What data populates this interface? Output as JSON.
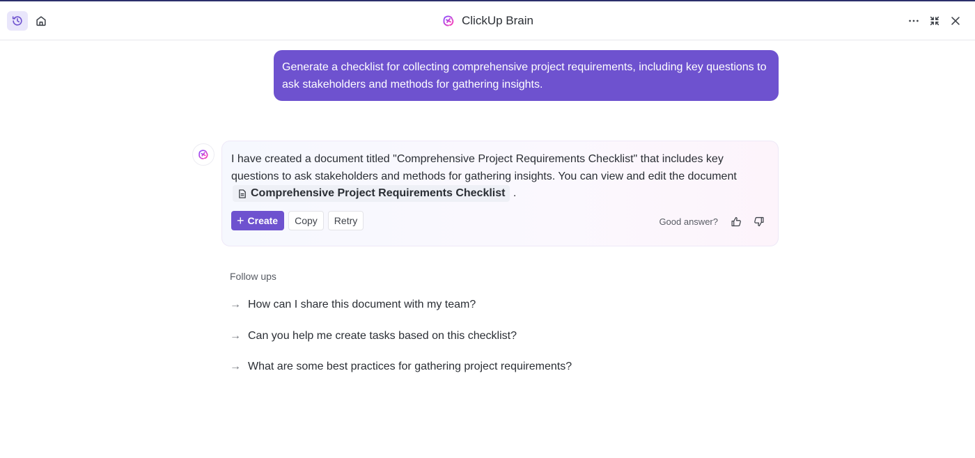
{
  "header": {
    "title": "ClickUp Brain",
    "left_icons": [
      "history-icon",
      "home-icon"
    ],
    "right_icons": [
      "more-icon",
      "collapse-icon",
      "close-icon"
    ]
  },
  "user_message": "Generate a checklist for collecting comprehensive project requirements, including key questions to ask stakeholders and methods for gathering insights.",
  "answer": {
    "text_before": "I have created a document titled \"Comprehensive Project Requirements Checklist\" that includes key questions to ask stakeholders and methods for gathering insights. You can view and edit the document",
    "doc_link": "Comprehensive Project Requirements Checklist",
    "text_after": ".",
    "actions": {
      "create": "Create",
      "copy": "Copy",
      "retry": "Retry"
    },
    "feedback_label": "Good answer?"
  },
  "followups": {
    "label": "Follow ups",
    "items": [
      "How can I share this document with my team?",
      "Can you help me create tasks based on this checklist?",
      "What are some best practices for gathering project requirements?"
    ]
  },
  "colors": {
    "accent": "#6e52cf",
    "brain_pink": "#d63be0"
  }
}
